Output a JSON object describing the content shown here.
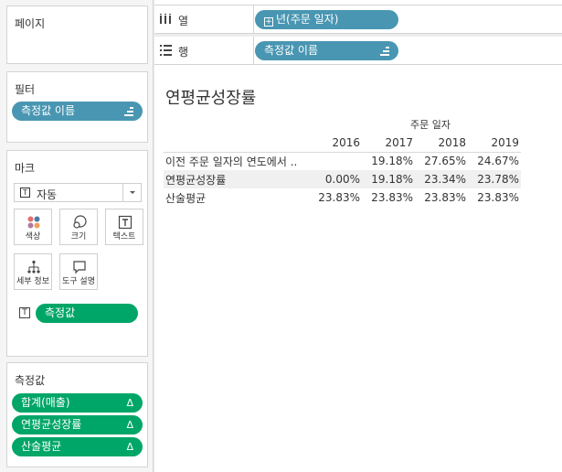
{
  "shelves": {
    "pages_label": "페이지",
    "columns_label": "열",
    "columns_pill": "년(주문 일자)",
    "rows_label": "행",
    "rows_pill": "측정값 이름"
  },
  "filters": {
    "title": "필터",
    "pill": "측정값 이름"
  },
  "marks": {
    "title": "마크",
    "type": "자동",
    "buttons": [
      "색상",
      "크기",
      "텍스트",
      "세부 정보",
      "도구 설명"
    ],
    "text_pill": "측정값"
  },
  "measures": {
    "title": "측정값",
    "pills": [
      "합계(매출)",
      "연평균성장률",
      "산술평균"
    ],
    "delta_symbol": "Δ"
  },
  "view": {
    "title": "연평균성장률",
    "column_header": "주문 일자",
    "years": [
      "2016",
      "2017",
      "2018",
      "2019"
    ],
    "rows": [
      {
        "name": "이전 주문 일자의 연도에서 ..",
        "values": [
          "",
          "19.18%",
          "27.65%",
          "24.67%"
        ]
      },
      {
        "name": "연평균성장률",
        "values": [
          "0.00%",
          "19.18%",
          "23.34%",
          "23.78%"
        ]
      },
      {
        "name": "산술평균",
        "values": [
          "23.83%",
          "23.83%",
          "23.83%",
          "23.83%"
        ]
      }
    ]
  },
  "colors": {
    "dimension_pill": "#4996b2",
    "measure_pill": "#00a667"
  }
}
